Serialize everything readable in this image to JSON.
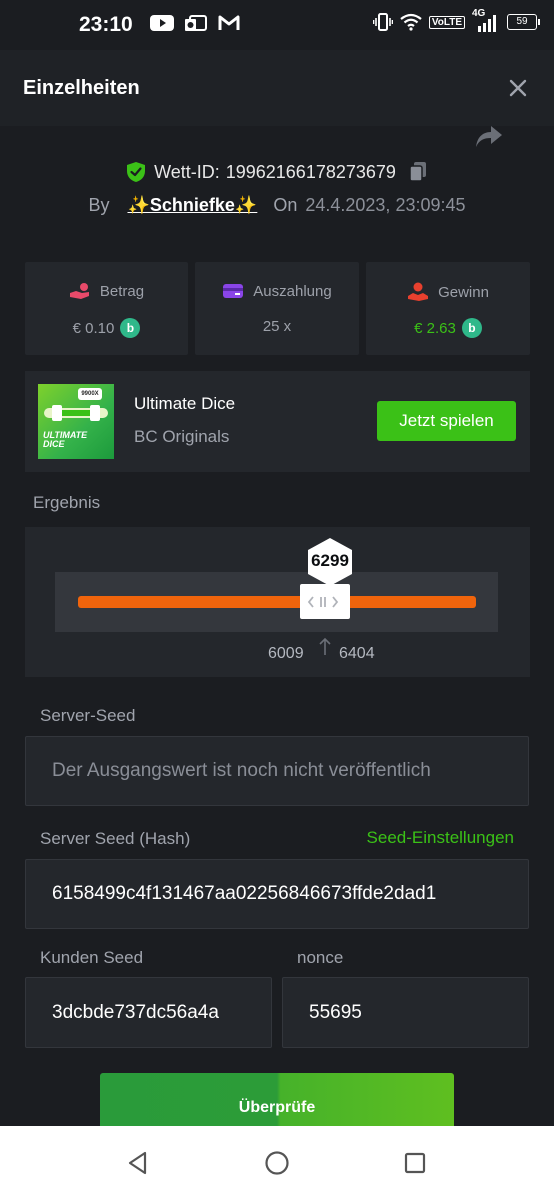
{
  "status_bar": {
    "time": "23:10",
    "volte": "VoLTE",
    "network": "4G",
    "battery": "59"
  },
  "header": {
    "title": "Einzelheiten"
  },
  "bet": {
    "id_label": "Wett-ID:",
    "id_value": "19962166178273679",
    "by_label": "By",
    "user": "✨Schniefke✨",
    "on_label": "On",
    "date": "24.4.2023, 23:09:45"
  },
  "stats": [
    {
      "label": "Betrag",
      "value": "€ 0.10",
      "coin": "b",
      "value_color": "#9da1aa",
      "icon": "hand-coins-icon"
    },
    {
      "label": "Auszahlung",
      "value": "25 x",
      "value_color": "#9da1aa",
      "icon": "wallet-card-icon"
    },
    {
      "label": "Gewinn",
      "value": "€ 2.63",
      "coin": "b",
      "value_color": "#3bc117",
      "icon": "hand-receive-icon"
    }
  ],
  "game": {
    "name": "Ultimate Dice",
    "provider": "BC Originals",
    "play_label": "Jetzt spielen",
    "thumb_text": "ULTIMATE DICE",
    "thumb_badge": "9900X"
  },
  "result": {
    "section_label": "Ergebnis",
    "value": "6299",
    "range_low": "6009",
    "range_high": "6404"
  },
  "server_seed": {
    "label": "Server-Seed",
    "placeholder": "Der Ausgangswert ist noch nicht veröffentlich"
  },
  "server_seed_hash": {
    "label": "Server Seed (Hash)",
    "settings_link": "Seed-Einstellungen",
    "value": "6158499c4f131467aa02256846673ffde2dad1"
  },
  "client_seed": {
    "label": "Kunden Seed",
    "value": "3dcbde737dc56a4a"
  },
  "nonce": {
    "label": "nonce",
    "value": "55695"
  },
  "verify_label": "Überprüfe",
  "colors": {
    "accent_green": "#3bc117",
    "slider_orange": "#f0640c",
    "card_bg": "#24272c",
    "page_bg": "#1b1d21"
  }
}
